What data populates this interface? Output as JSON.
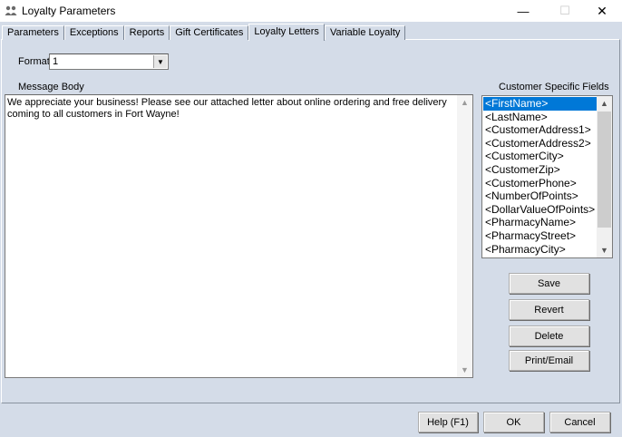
{
  "window": {
    "title": "Loyalty Parameters",
    "minimize_glyph": "—",
    "maximize_glyph": "☐",
    "close_glyph": "✕"
  },
  "tabs": [
    {
      "label": "Parameters",
      "active": false
    },
    {
      "label": "Exceptions",
      "active": false
    },
    {
      "label": "Reports",
      "active": false
    },
    {
      "label": "Gift Certificates",
      "active": false
    },
    {
      "label": "Loyalty Letters",
      "active": true
    },
    {
      "label": "Variable Loyalty",
      "active": false
    }
  ],
  "format": {
    "label": "Format:",
    "value": "1"
  },
  "message_body": {
    "label": "Message Body",
    "text": "We appreciate your business! Please see our attached letter about online ordering and free delivery coming to all customers in Fort Wayne!"
  },
  "customer_fields": {
    "label": "Customer Specific Fields",
    "items": [
      "<FirstName>",
      "<LastName>",
      "<CustomerAddress1>",
      "<CustomerAddress2>",
      "<CustomerCity>",
      "<CustomerZip>",
      "<CustomerPhone>",
      "<NumberOfPoints>",
      "<DollarValueOfPoints>",
      "<PharmacyName>",
      "<PharmacyStreet>",
      "<PharmacyCity>"
    ],
    "selected_index": 0
  },
  "side_buttons": {
    "save": "Save",
    "revert": "Revert",
    "delete": "Delete",
    "print_email": "Print/Email"
  },
  "footer_buttons": {
    "help": "Help (F1)",
    "ok": "OK",
    "cancel": "Cancel"
  },
  "colors": {
    "client_background": "#d4dce8",
    "selection": "#0078d7"
  }
}
